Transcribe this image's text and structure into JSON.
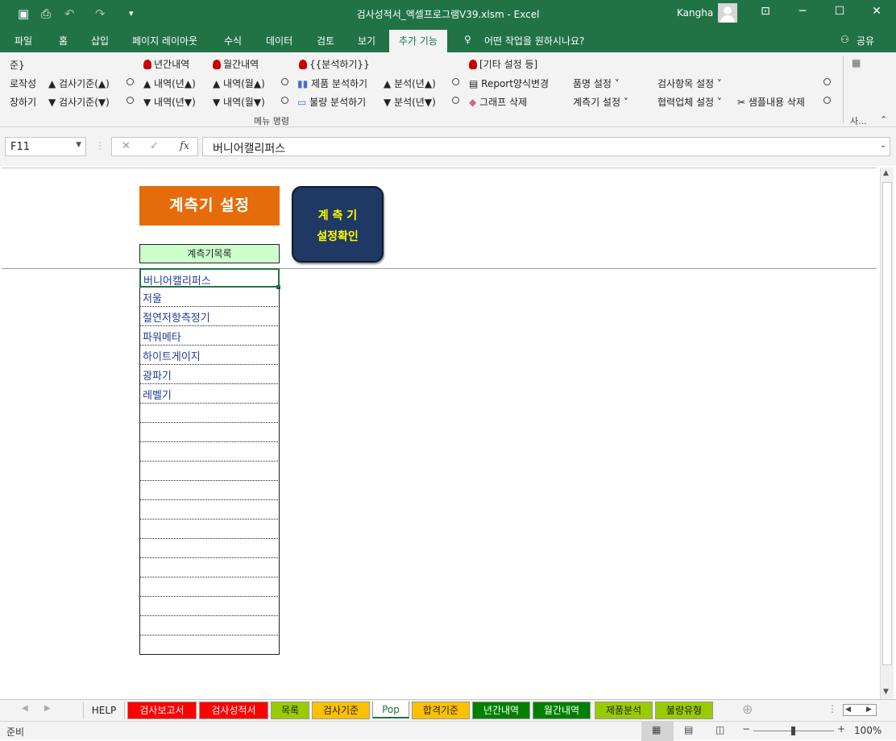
{
  "titlebar": {
    "title": "검사성적서_엑셀프로그램V39.xlsm  -  Excel",
    "user": "Kangha"
  },
  "tabs": [
    "파일",
    "홈",
    "삽입",
    "페이지 레이아웃",
    "수식",
    "데이터",
    "검토",
    "보기",
    "추가 기능",
    "어떤 작업을 원하시나요?",
    "공유"
  ],
  "ribbon": {
    "row1": [
      "준}",
      "년간내역",
      "월간내역",
      "{{분석하기}}",
      "[기타 설정 등]"
    ],
    "row2": [
      "로작성",
      "▲ 검사기준(▲)",
      "▲ 내역(년▲)",
      "▲ 내역(월▲)",
      "제품 분석하기",
      "▲ 분석(년▲)",
      "Report양식변경",
      "품명 설정 ˅",
      "검사항목 설정 ˅"
    ],
    "row3": [
      "장하기",
      "▼ 검사기준(▼)",
      "▼ 내역(년▼)",
      "▼ 내역(월▼)",
      "불량 분석하기",
      "▼ 분석(년▼)",
      "그래프 삭제",
      "계측기 설정 ˅",
      "협력업체 설정 ˅",
      "샘플내용 삭제"
    ],
    "group_label": "메뉴 명령",
    "collapsed_label": "사..."
  },
  "formula": {
    "namebox": "F11",
    "fx": "fx",
    "value": "버니어캘리퍼스"
  },
  "sheet": {
    "title_button": "계측기 설정",
    "confirm_button_line1": "계 측 기",
    "confirm_button_line2": "설정확인",
    "list_header": "계측기목록",
    "list_items": [
      "버니어캘리퍼스",
      "저울",
      "절연저항측정기",
      "파워메타",
      "하이트게이지",
      "광파기",
      "레벨기",
      "",
      "",
      "",
      "",
      "",
      "",
      "",
      "",
      "",
      "",
      "",
      "",
      ""
    ]
  },
  "sheet_tabs": [
    "HELP",
    "검사보고서",
    "검사성적서",
    "목록",
    "검사기준",
    "Pop",
    "합격기준",
    "년간내역",
    "월간내역",
    "제품분석",
    "불량유형"
  ],
  "sheet_tab_colors": [
    "#f3f3f3",
    "#ff0000",
    "#ff0000",
    "#99cc00",
    "#ffc000",
    "#ffffff",
    "#ffc000",
    "#008000",
    "#008000",
    "#99cc00",
    "#99cc00"
  ],
  "status": {
    "ready": "준비",
    "zoom": "100%"
  }
}
